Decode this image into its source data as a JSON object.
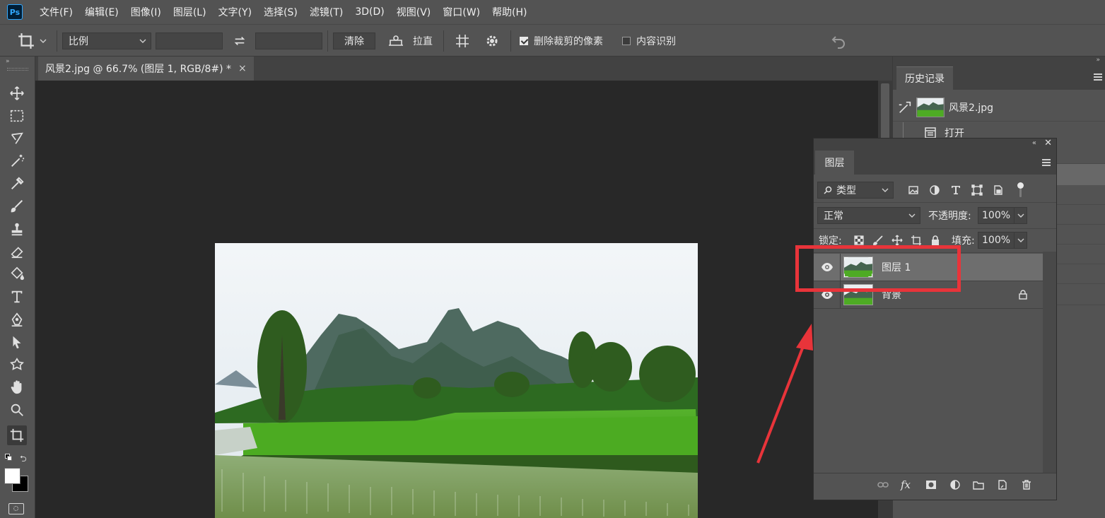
{
  "menubar": {
    "logo": "Ps",
    "items": [
      "文件(F)",
      "编辑(E)",
      "图像(I)",
      "图层(L)",
      "文字(Y)",
      "选择(S)",
      "滤镜(T)",
      "3D(D)",
      "视图(V)",
      "窗口(W)",
      "帮助(H)"
    ]
  },
  "options": {
    "ratio_select": "比例",
    "clear_label": "清除",
    "straighten_label": "拉直",
    "delete_pixels_label": "删除裁剪的像素",
    "delete_pixels_checked": true,
    "content_aware_label": "内容识别",
    "content_aware_checked": false
  },
  "document": {
    "tab_title": "风景2.jpg @ 66.7% (图层 1, RGB/8#) *",
    "close_glyph": "×"
  },
  "history": {
    "tab_label": "历史记录",
    "snapshot_name": "风景2.jpg",
    "steps": [
      "打开"
    ]
  },
  "layers": {
    "tab_label": "图层",
    "filter_kind": "类型",
    "blend_mode": "正常",
    "opacity_label": "不透明度:",
    "opacity_value": "100%",
    "lock_label": "锁定:",
    "fill_label": "填充:",
    "fill_value": "100%",
    "items": [
      {
        "name": "图层 1",
        "selected": true,
        "locked": false
      },
      {
        "name": "背景",
        "selected": false,
        "locked": true
      }
    ],
    "fx_label": "fx"
  },
  "colors": {
    "ui_bg": "#535353",
    "canvas_bg": "#282828",
    "selected_layer": "#6e6e6e",
    "annotation_red": "#e8343a"
  }
}
